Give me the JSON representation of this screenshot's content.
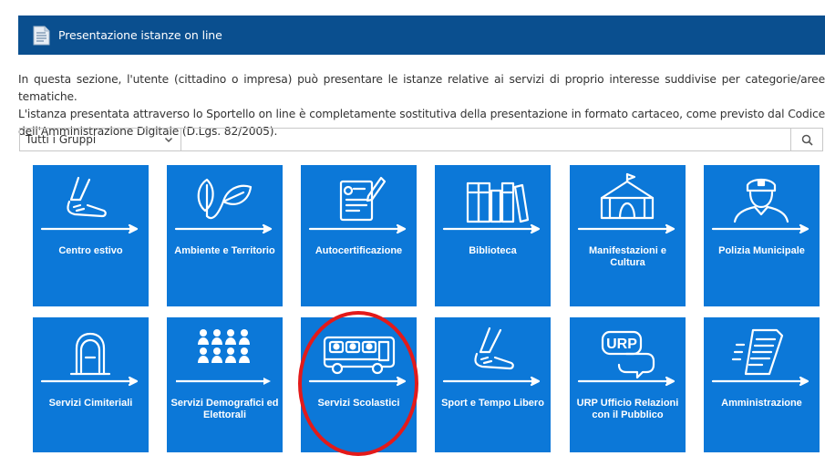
{
  "header": {
    "title": "Presentazione istanze on line",
    "icon": "document-icon"
  },
  "intro": {
    "line1": "In questa sezione, l'utente (cittadino o impresa) può presentare le istanze relative ai servizi di proprio interesse suddivise per categorie/aree tematiche.",
    "line2": "L'istanza presentata attraverso lo Sportello on line è completamente sostitutiva della presentazione in formato cartaceo, come previsto dal Codice dell'Amministrazione Digitale (D.Lgs. 82/2005)."
  },
  "filter": {
    "group_select": "Tutti i Gruppi",
    "search_value": "",
    "search_icon": "search-icon"
  },
  "tiles": [
    {
      "label": "Centro estivo",
      "icon": "running-shoe-icon"
    },
    {
      "label": "Ambiente e Territorio",
      "icon": "leaves-icon"
    },
    {
      "label": "Autocertificazione",
      "icon": "document-pen-icon"
    },
    {
      "label": "Biblioteca",
      "icon": "books-icon"
    },
    {
      "label": "Manifestazioni e Cultura",
      "icon": "circus-tent-icon"
    },
    {
      "label": "Polizia Municipale",
      "icon": "police-officer-icon"
    },
    {
      "label": "Servizi Cimiteriali",
      "icon": "tombstone-icon"
    },
    {
      "label": "Servizi Demografici ed Elettorali",
      "icon": "people-group-icon"
    },
    {
      "label": "Servizi Scolastici",
      "icon": "school-bus-icon"
    },
    {
      "label": "Sport e Tempo Libero",
      "icon": "sport-shoe-icon"
    },
    {
      "label": "URP Ufficio Relazioni con il Pubblico",
      "icon": "urp-speech-bubble-icon"
    },
    {
      "label": "Amministrazione",
      "icon": "document-lines-icon"
    }
  ],
  "colors": {
    "header_bg": "#0a4f8f",
    "tile_bg": "#0c78d8",
    "highlight_circle": "#e31a1a"
  }
}
